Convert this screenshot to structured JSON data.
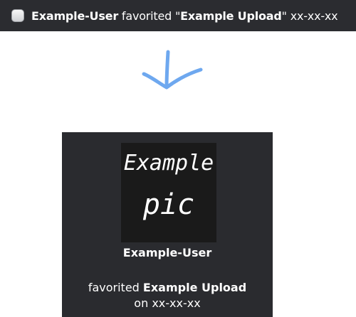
{
  "notification": {
    "user": "Example-User",
    "action": "favorited",
    "quote_open": "\"",
    "upload_title": "Example Upload",
    "quote_close": "\"",
    "date": "xx-xx-xx",
    "avatar_icon": "avatar-icon"
  },
  "arrow": {
    "icon": "arrow-down-icon",
    "color": "#6ea8ef"
  },
  "card": {
    "thumbnail_text_line1": "Example",
    "thumbnail_text_line2": "pic",
    "user": "Example-User",
    "action": "favorited",
    "upload_title": "Example Upload",
    "on_label": "on",
    "date": "xx-xx-xx"
  },
  "colors": {
    "topbar_bg": "#2b2c30",
    "card_bg": "#2a2b2f",
    "thumb_bg": "#1a1a1a",
    "accent": "#6ea8ef"
  }
}
